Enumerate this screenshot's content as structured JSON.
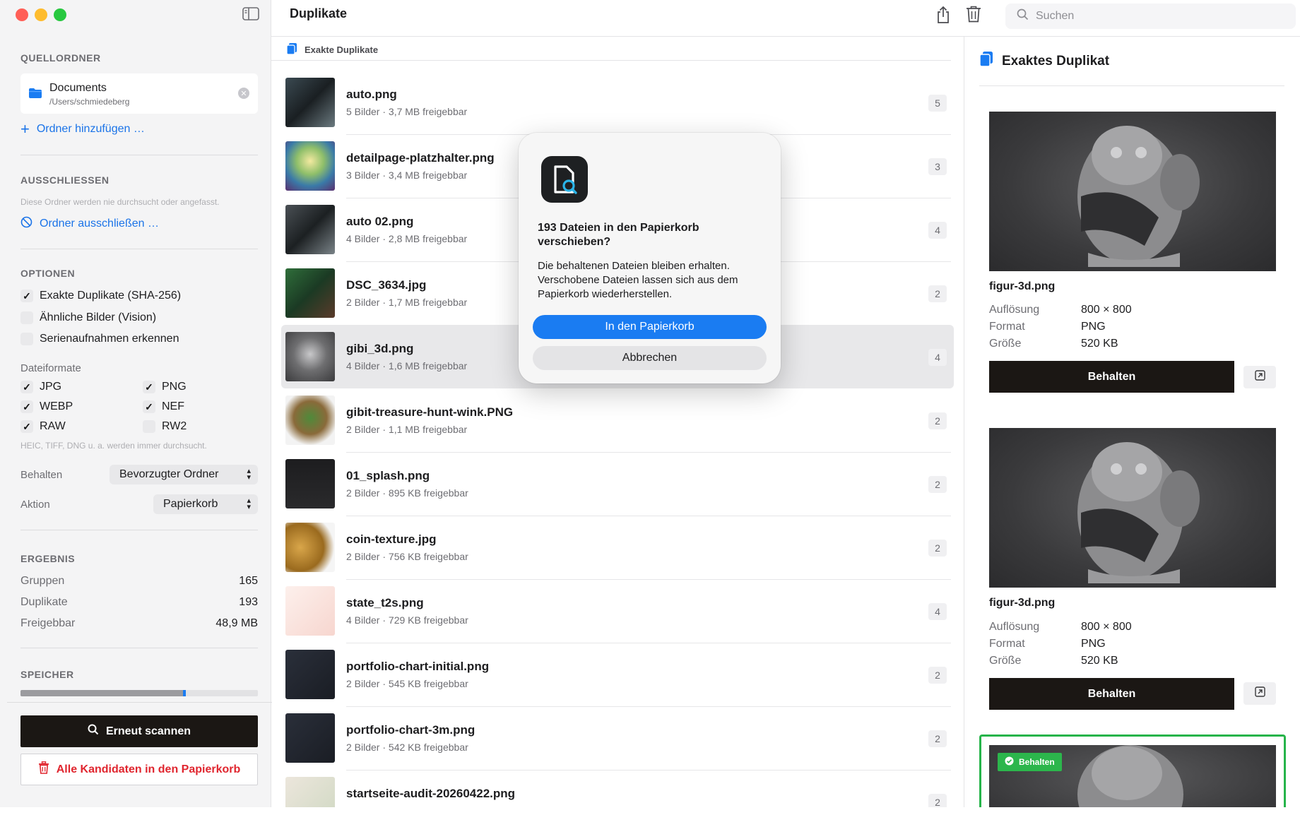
{
  "window": {
    "title": "Duplikate"
  },
  "sidebar": {
    "source_heading": "QUELLORDNER",
    "source": {
      "name": "Documents",
      "path": "/Users/schmiedeberg"
    },
    "add_folder": "Ordner hinzufügen …",
    "exclude_heading": "AUSSCHLIESSEN",
    "exclude_hint": "Diese Ordner werden nie durchsucht oder angefasst.",
    "exclude_link": "Ordner ausschließen …",
    "options_heading": "OPTIONEN",
    "options": [
      {
        "label": "Exakte Duplikate (SHA-256)",
        "checked": true
      },
      {
        "label": "Ähnliche Bilder (Vision)",
        "checked": false
      },
      {
        "label": "Serienaufnahmen erkennen",
        "checked": false
      }
    ],
    "formats_heading": "Dateiformate",
    "formats": [
      {
        "label": "JPG",
        "checked": true
      },
      {
        "label": "PNG",
        "checked": true
      },
      {
        "label": "WEBP",
        "checked": true
      },
      {
        "label": "NEF",
        "checked": true
      },
      {
        "label": "RAW",
        "checked": true
      },
      {
        "label": "RW2",
        "checked": false
      }
    ],
    "formats_hint": "HEIC, TIFF, DNG u. a. werden immer durchsucht.",
    "keep_label": "Behalten",
    "keep_value": "Bevorzugter Ordner",
    "action_label": "Aktion",
    "action_value": "Papierkorb",
    "result_heading": "ERGEBNIS",
    "results": [
      {
        "label": "Gruppen",
        "value": "165"
      },
      {
        "label": "Duplikate",
        "value": "193"
      },
      {
        "label": "Freigebbar",
        "value": "48,9 MB"
      }
    ],
    "storage_heading": "SPEICHER",
    "storage_fraction": 0.69,
    "rescan_button": "Erneut scannen",
    "trash_all_button": "Alle Kandidaten in den Papierkorb"
  },
  "toolbar": {
    "search_placeholder": "Suchen"
  },
  "list": {
    "section": "Exakte Duplikate",
    "items": [
      {
        "name": "auto.png",
        "sub": "5 Bilder · 3,7 MB freigebbar",
        "count": "5"
      },
      {
        "name": "detailpage-platzhalter.png",
        "sub": "3 Bilder · 3,4 MB freigebbar",
        "count": "3"
      },
      {
        "name": "auto 02.png",
        "sub": "4 Bilder · 2,8 MB freigebbar",
        "count": "4"
      },
      {
        "name": "DSC_3634.jpg",
        "sub": "2 Bilder · 1,7 MB freigebbar",
        "count": "2"
      },
      {
        "name": "gibi_3d.png",
        "sub": "4 Bilder · 1,6 MB freigebbar",
        "count": "4"
      },
      {
        "name": "gibit-treasure-hunt-wink.PNG",
        "sub": "2 Bilder · 1,1 MB freigebbar",
        "count": "2"
      },
      {
        "name": "01_splash.png",
        "sub": "2 Bilder · 895 KB freigebbar",
        "count": "2"
      },
      {
        "name": "coin-texture.jpg",
        "sub": "2 Bilder · 756 KB freigebbar",
        "count": "2"
      },
      {
        "name": "state_t2s.png",
        "sub": "4 Bilder · 729 KB freigebbar",
        "count": "4"
      },
      {
        "name": "portfolio-chart-initial.png",
        "sub": "2 Bilder · 545 KB freigebbar",
        "count": "2"
      },
      {
        "name": "portfolio-chart-3m.png",
        "sub": "2 Bilder · 542 KB freigebbar",
        "count": "2"
      },
      {
        "name": "startseite-audit-20260422.png",
        "sub": "",
        "count": "2"
      }
    ]
  },
  "detail": {
    "heading": "Exaktes Duplikat",
    "cards": [
      {
        "name": "figur-3d.png",
        "res_label": "Auflösung",
        "res": "800 × 800",
        "fmt_label": "Format",
        "fmt": "PNG",
        "size_label": "Größe",
        "size": "520 KB",
        "keep": "Behalten"
      },
      {
        "name": "figur-3d.png",
        "res_label": "Auflösung",
        "res": "800 × 800",
        "fmt_label": "Format",
        "fmt": "PNG",
        "size_label": "Größe",
        "size": "520 KB",
        "keep": "Behalten"
      }
    ],
    "badge": "Behalten"
  },
  "dialog": {
    "title": "193 Dateien in den Papierkorb verschieben?",
    "text": "Die behaltenen Dateien bleiben erhalten. Verschobene Dateien lassen sich aus dem Papierkorb wiederherstellen.",
    "confirm": "In den Papierkorb",
    "cancel": "Abbrechen"
  },
  "colors": {
    "accent": "#1a7cf2",
    "danger": "#e0262f",
    "keep_green": "#2cb64c",
    "dark_button": "#1b1714"
  }
}
